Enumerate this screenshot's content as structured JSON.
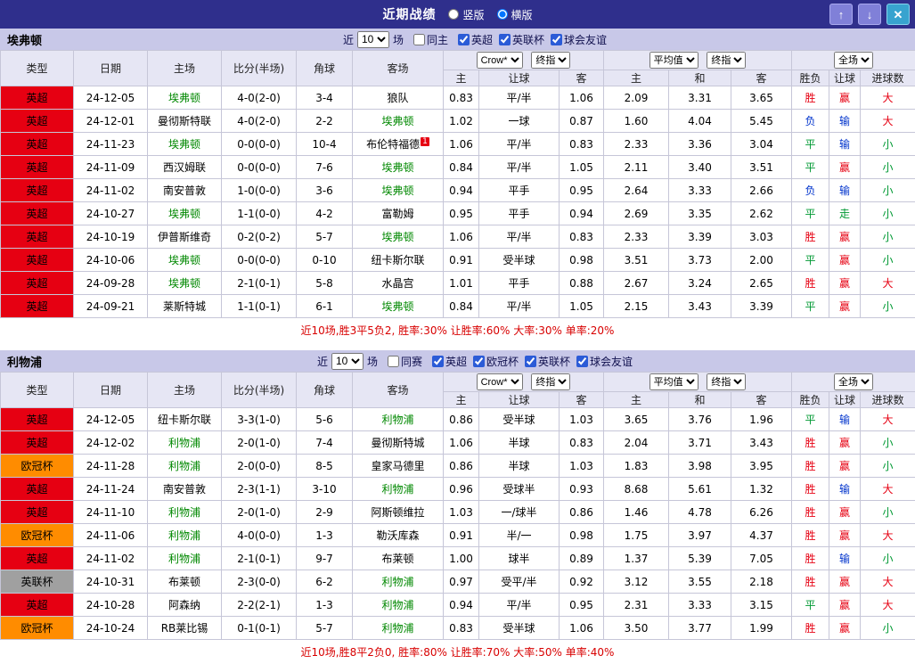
{
  "topbar": {
    "title": "近期战绩",
    "layout_options": [
      {
        "label": "竖版",
        "selected": false
      },
      {
        "label": "横版",
        "selected": true
      }
    ],
    "up_icon": "↑",
    "down_icon": "↓",
    "close_icon": "✕"
  },
  "table": {
    "col_headers": [
      "类型",
      "日期",
      "主场",
      "比分(半场)",
      "角球",
      "客场"
    ],
    "sub_headers": [
      "主",
      "让球",
      "客",
      "主",
      "和",
      "客",
      "胜负",
      "让球",
      "进球数"
    ]
  },
  "colors": {
    "ui": {
      "topbar-bg": "#2f2f8c",
      "bar-bg": "#c8c8e8",
      "header-bg": "#e6e6f4",
      "grid": "#c6c6d8",
      "btn-purple": "#8080d8",
      "btn-close": "#38a3cf",
      "score": "#e60012",
      "team": "#008800",
      "summary": "#d80000"
    },
    "league": {
      "英超": "#e60012",
      "欧冠杯": "#ff8c00",
      "英联杯": "#a0a0a0"
    },
    "value": {
      "胜": "#e60012",
      "平": "#009933",
      "负": "#0033cc",
      "赢": "#e60012",
      "输": "#0033cc",
      "走": "#009933",
      "大": "#e60012",
      "小": "#009933"
    }
  },
  "sections": [
    {
      "team": "埃弗顿",
      "filter": {
        "near": "近",
        "count": "10",
        "unit": "场",
        "same_label": "同主",
        "same_checked": false,
        "leagues": [
          {
            "label": "英超",
            "checked": true
          },
          {
            "label": "英联杯",
            "checked": true
          },
          {
            "label": "球会友谊",
            "checked": true
          }
        ]
      },
      "dropdowns": {
        "bookmaker": "Crow*",
        "final_a": "终指",
        "average": "平均值",
        "final_b": "终指",
        "scope": "全场"
      },
      "rows": [
        {
          "league": "英超",
          "date": "24-12-05",
          "home": "埃弗顿",
          "score": "4-0(2-0)",
          "corners": "3-4",
          "away": "狼队",
          "ah": "0.83",
          "line": "平/半",
          "aa": "1.06",
          "eh": "2.09",
          "ed": "3.31",
          "ea": "3.65",
          "result": "胜",
          "cover": "赢",
          "goals": "大"
        },
        {
          "league": "英超",
          "date": "24-12-01",
          "home": "曼彻斯特联",
          "score": "4-0(2-0)",
          "corners": "2-2",
          "away": "埃弗顿",
          "ah": "1.02",
          "line": "一球",
          "aa": "0.87",
          "eh": "1.60",
          "ed": "4.04",
          "ea": "5.45",
          "result": "负",
          "cover": "输",
          "goals": "大"
        },
        {
          "league": "英超",
          "date": "24-11-23",
          "home": "埃弗顿",
          "score": "0-0(0-0)",
          "corners": "10-4",
          "away": "布伦特福德",
          "away_sup": "1",
          "ah": "1.06",
          "line": "平/半",
          "aa": "0.83",
          "eh": "2.33",
          "ed": "3.36",
          "ea": "3.04",
          "result": "平",
          "cover": "输",
          "goals": "小"
        },
        {
          "league": "英超",
          "date": "24-11-09",
          "home": "西汉姆联",
          "score": "0-0(0-0)",
          "corners": "7-6",
          "away": "埃弗顿",
          "ah": "0.84",
          "line": "平/半",
          "aa": "1.05",
          "eh": "2.11",
          "ed": "3.40",
          "ea": "3.51",
          "result": "平",
          "cover": "赢",
          "goals": "小"
        },
        {
          "league": "英超",
          "date": "24-11-02",
          "home": "南安普敦",
          "score": "1-0(0-0)",
          "corners": "3-6",
          "away": "埃弗顿",
          "ah": "0.94",
          "line": "平手",
          "aa": "0.95",
          "eh": "2.64",
          "ed": "3.33",
          "ea": "2.66",
          "result": "负",
          "cover": "输",
          "goals": "小"
        },
        {
          "league": "英超",
          "date": "24-10-27",
          "home": "埃弗顿",
          "score": "1-1(0-0)",
          "corners": "4-2",
          "away": "富勒姆",
          "ah": "0.95",
          "line": "平手",
          "aa": "0.94",
          "eh": "2.69",
          "ed": "3.35",
          "ea": "2.62",
          "result": "平",
          "cover": "走",
          "goals": "小"
        },
        {
          "league": "英超",
          "date": "24-10-19",
          "home": "伊普斯维奇",
          "score": "0-2(0-2)",
          "corners": "5-7",
          "away": "埃弗顿",
          "ah": "1.06",
          "line": "平/半",
          "aa": "0.83",
          "eh": "2.33",
          "ed": "3.39",
          "ea": "3.03",
          "result": "胜",
          "cover": "赢",
          "goals": "小"
        },
        {
          "league": "英超",
          "date": "24-10-06",
          "home": "埃弗顿",
          "score": "0-0(0-0)",
          "corners": "0-10",
          "away": "纽卡斯尔联",
          "ah": "0.91",
          "line": "受半球",
          "aa": "0.98",
          "eh": "3.51",
          "ed": "3.73",
          "ea": "2.00",
          "result": "平",
          "cover": "赢",
          "goals": "小"
        },
        {
          "league": "英超",
          "date": "24-09-28",
          "home": "埃弗顿",
          "score": "2-1(0-1)",
          "corners": "5-8",
          "away": "水晶宫",
          "ah": "1.01",
          "line": "平手",
          "aa": "0.88",
          "eh": "2.67",
          "ed": "3.24",
          "ea": "2.65",
          "result": "胜",
          "cover": "赢",
          "goals": "大"
        },
        {
          "league": "英超",
          "date": "24-09-21",
          "home": "莱斯特城",
          "score": "1-1(0-1)",
          "corners": "6-1",
          "away": "埃弗顿",
          "ah": "0.84",
          "line": "平/半",
          "aa": "1.05",
          "eh": "2.15",
          "ed": "3.43",
          "ea": "3.39",
          "result": "平",
          "cover": "赢",
          "goals": "小"
        }
      ],
      "summary": "近10场,胜3平5负2, 胜率:30% 让胜率:60% 大率:30% 单率:20%"
    },
    {
      "team": "利物浦",
      "filter": {
        "near": "近",
        "count": "10",
        "unit": "场",
        "same_label": "同赛",
        "same_checked": false,
        "leagues": [
          {
            "label": "英超",
            "checked": true
          },
          {
            "label": "欧冠杯",
            "checked": true
          },
          {
            "label": "英联杯",
            "checked": true
          },
          {
            "label": "球会友谊",
            "checked": true
          }
        ]
      },
      "dropdowns": {
        "bookmaker": "Crow*",
        "final_a": "终指",
        "average": "平均值",
        "final_b": "终指",
        "scope": "全场"
      },
      "rows": [
        {
          "league": "英超",
          "date": "24-12-05",
          "home": "纽卡斯尔联",
          "score": "3-3(1-0)",
          "corners": "5-6",
          "away": "利物浦",
          "ah": "0.86",
          "line": "受半球",
          "aa": "1.03",
          "eh": "3.65",
          "ed": "3.76",
          "ea": "1.96",
          "result": "平",
          "cover": "输",
          "goals": "大"
        },
        {
          "league": "英超",
          "date": "24-12-02",
          "home": "利物浦",
          "score": "2-0(1-0)",
          "corners": "7-4",
          "away": "曼彻斯特城",
          "ah": "1.06",
          "line": "半球",
          "aa": "0.83",
          "eh": "2.04",
          "ed": "3.71",
          "ea": "3.43",
          "result": "胜",
          "cover": "赢",
          "goals": "小"
        },
        {
          "league": "欧冠杯",
          "date": "24-11-28",
          "home": "利物浦",
          "score": "2-0(0-0)",
          "corners": "8-5",
          "away": "皇家马德里",
          "ah": "0.86",
          "line": "半球",
          "aa": "1.03",
          "eh": "1.83",
          "ed": "3.98",
          "ea": "3.95",
          "result": "胜",
          "cover": "赢",
          "goals": "小"
        },
        {
          "league": "英超",
          "date": "24-11-24",
          "home": "南安普敦",
          "score": "2-3(1-1)",
          "corners": "3-10",
          "away": "利物浦",
          "ah": "0.96",
          "line": "受球半",
          "aa": "0.93",
          "eh": "8.68",
          "ed": "5.61",
          "ea": "1.32",
          "result": "胜",
          "cover": "输",
          "goals": "大"
        },
        {
          "league": "英超",
          "date": "24-11-10",
          "home": "利物浦",
          "score": "2-0(1-0)",
          "corners": "2-9",
          "away": "阿斯顿维拉",
          "ah": "1.03",
          "line": "一/球半",
          "aa": "0.86",
          "eh": "1.46",
          "ed": "4.78",
          "ea": "6.26",
          "result": "胜",
          "cover": "赢",
          "goals": "小"
        },
        {
          "league": "欧冠杯",
          "date": "24-11-06",
          "home": "利物浦",
          "score": "4-0(0-0)",
          "corners": "1-3",
          "away": "勒沃库森",
          "ah": "0.91",
          "line": "半/一",
          "aa": "0.98",
          "eh": "1.75",
          "ed": "3.97",
          "ea": "4.37",
          "result": "胜",
          "cover": "赢",
          "goals": "大"
        },
        {
          "league": "英超",
          "date": "24-11-02",
          "home": "利物浦",
          "score": "2-1(0-1)",
          "corners": "9-7",
          "away": "布莱顿",
          "ah": "1.00",
          "line": "球半",
          "aa": "0.89",
          "eh": "1.37",
          "ed": "5.39",
          "ea": "7.05",
          "result": "胜",
          "cover": "输",
          "goals": "小"
        },
        {
          "league": "英联杯",
          "date": "24-10-31",
          "home": "布莱顿",
          "score": "2-3(0-0)",
          "corners": "6-2",
          "away": "利物浦",
          "ah": "0.97",
          "line": "受平/半",
          "aa": "0.92",
          "eh": "3.12",
          "ed": "3.55",
          "ea": "2.18",
          "result": "胜",
          "cover": "赢",
          "goals": "大"
        },
        {
          "league": "英超",
          "date": "24-10-28",
          "home": "阿森纳",
          "score": "2-2(2-1)",
          "corners": "1-3",
          "away": "利物浦",
          "ah": "0.94",
          "line": "平/半",
          "aa": "0.95",
          "eh": "2.31",
          "ed": "3.33",
          "ea": "3.15",
          "result": "平",
          "cover": "赢",
          "goals": "大"
        },
        {
          "league": "欧冠杯",
          "date": "24-10-24",
          "home": "RB莱比锡",
          "score": "0-1(0-1)",
          "corners": "5-7",
          "away": "利物浦",
          "ah": "0.83",
          "line": "受半球",
          "aa": "1.06",
          "eh": "3.50",
          "ed": "3.77",
          "ea": "1.99",
          "result": "胜",
          "cover": "赢",
          "goals": "小"
        }
      ],
      "summary": "近10场,胜8平2负0, 胜率:80% 让胜率:70% 大率:50% 单率:40%"
    }
  ]
}
